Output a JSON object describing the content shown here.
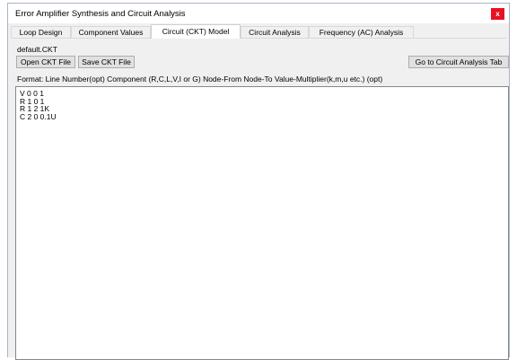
{
  "window": {
    "title": "Error Amplifier Synthesis and Circuit Analysis",
    "close_label": "x"
  },
  "tabs": [
    {
      "label": "Loop Design",
      "active": false
    },
    {
      "label": "Component Values",
      "active": false
    },
    {
      "label": "Circuit (CKT) Model",
      "active": true
    },
    {
      "label": "Circuit Analysis",
      "active": false
    },
    {
      "label": "Frequency (AC) Analysis",
      "active": false
    }
  ],
  "file": {
    "name": "default.CKT"
  },
  "toolbar": {
    "open_label": "Open CKT File",
    "save_label": "Save CKT File",
    "goto_label": "Go to Circuit Analysis Tab"
  },
  "format_line": "Format:  Line Number(opt)   Component (R,C,L,V,I or G)  Node-From   Node-To   Value-Multiplier(k,m,u etc.) (opt)",
  "editor": {
    "lines": [
      "V 0 0 1",
      "R 1 0 1",
      "R 1 2 1K",
      "C 2 0 0.1U"
    ]
  }
}
